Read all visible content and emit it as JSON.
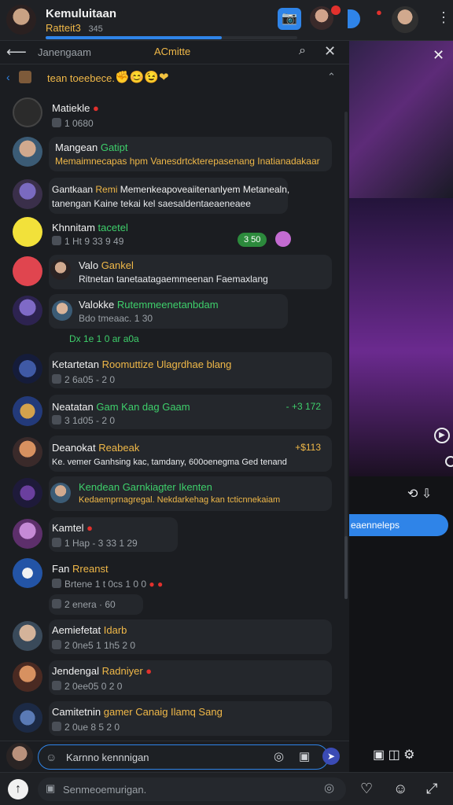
{
  "header": {
    "title": "Kemuluitaan",
    "subtitle": "Ratteit3",
    "subcount": "345",
    "colors": {
      "accent": "#2f84e8",
      "brand": "#f0b848",
      "online": "#3ecf6b"
    }
  },
  "search": {
    "left_label": "Janengaam",
    "mid_label": "ACmitte",
    "search_icon": "search-icon",
    "close_icon": "close-icon"
  },
  "filter": {
    "text": "tean toeebece.",
    "emojis": "✊😊😉❤"
  },
  "messages": [
    {
      "name": "Matiekle",
      "meta": "1 0680"
    },
    {
      "name": "Mangean",
      "name_hl": "Gatipt",
      "text": "Memaimnecapas hpm Vanesdrtckterepasenang Inatianadakaar"
    },
    {
      "name": "Gantkaan",
      "name_hl": "Remi",
      "text": "Memenkeapoveaiitenanlyem Metanealn,",
      "text2": "tanengan",
      "text2_hl": "Kaine tekai kel saesaldentaeaeneaee"
    },
    {
      "name": "Khnnitam",
      "name_hl": "tacetel",
      "meta": "1 Ht 9 33  9 49",
      "badge": "3 50"
    },
    {
      "name": "Valo",
      "name_hl": "Gankel",
      "text": "Ritnetan tanetaatagaemmeenan Faemaxlang"
    },
    {
      "name": "Valokke",
      "name_hl": "Rutemmeenetanbdam",
      "meta": "Bdo  tmeaac.   1 30",
      "meta2": "Dx 1e 1 0 ar a0a"
    },
    {
      "name": "Ketartetan",
      "name_hl": "Roomuttize Ulagrdhae blang",
      "meta": "2 6a05 - 2 0"
    },
    {
      "name": "Neatatan",
      "name_hl": "Gam Kan dag Gaam",
      "meta": "3 1d05  - 2 0",
      "right": "- +3 172"
    },
    {
      "name": "Deanokat",
      "name_hl": "Reabeak",
      "text": "Ke. vemer  Ganhsing kac, tamdany, 600oenegma Ged tenand",
      "right": "+$113"
    },
    {
      "name": "Kendean",
      "name_hl": "Garnkiagter Ikenten",
      "text": "Kedaemprnagregal. Nekdarkehag kan tcticnnekaiam"
    },
    {
      "name": "Kamtel",
      "meta": "1 Hap - 3 33   1 29"
    },
    {
      "name": "Fan",
      "name_hl": "Rreanst",
      "meta": "Brtene 1 t 0cs 1 0 0",
      "meta2": "2 enera  ·  60"
    },
    {
      "name": "Aemiefetat",
      "name_hl": "Idarb",
      "meta": "2 0ne5 1 1h5 2 0"
    },
    {
      "name": "Jendengal",
      "name_hl": "Radniyer",
      "meta": "2 0ee05 0  2 0"
    },
    {
      "name": "Camitetnin",
      "name_hl": "gamer Canaig Ilamq Sang",
      "meta": "2 0ue 8 5  2 0"
    }
  ],
  "composer": {
    "placeholder": "Karnno kennnigan",
    "send_icon": "send-icon"
  },
  "bottom": {
    "placeholder": "Senmeoemurigan."
  },
  "media": {
    "pill_label": "eaenneleps",
    "close_icon": "close-icon"
  }
}
